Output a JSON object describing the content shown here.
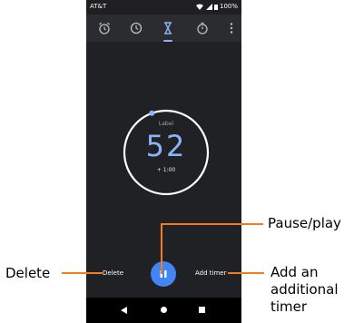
{
  "status_bar": {
    "carrier": "AT&T",
    "battery": "100%"
  },
  "tabs": [
    {
      "icon": "alarm-icon",
      "active": false
    },
    {
      "icon": "clock-icon",
      "active": false
    },
    {
      "icon": "timer-icon",
      "active": true
    },
    {
      "icon": "stopwatch-icon",
      "active": false
    },
    {
      "icon": "more-vert-icon",
      "active": false
    }
  ],
  "timer": {
    "label": "Label",
    "remaining": "52",
    "add_minute": "+ 1:00",
    "progress": 0.98
  },
  "controls": {
    "delete": "Delete",
    "add_timer": "Add timer",
    "play_pause_icon": "pause-icon"
  },
  "nav": [
    "back-icon",
    "home-icon",
    "recents-icon"
  ],
  "callouts": {
    "delete": "Delete",
    "pause_play": "Pause/play",
    "add_timer_line1": "Add an",
    "add_timer_line2": "additional",
    "add_timer_line3": "timer"
  },
  "colors": {
    "accent": "#8ab4f8",
    "button": "#4285f4",
    "callout": "#f47c20",
    "background": "#202124"
  }
}
